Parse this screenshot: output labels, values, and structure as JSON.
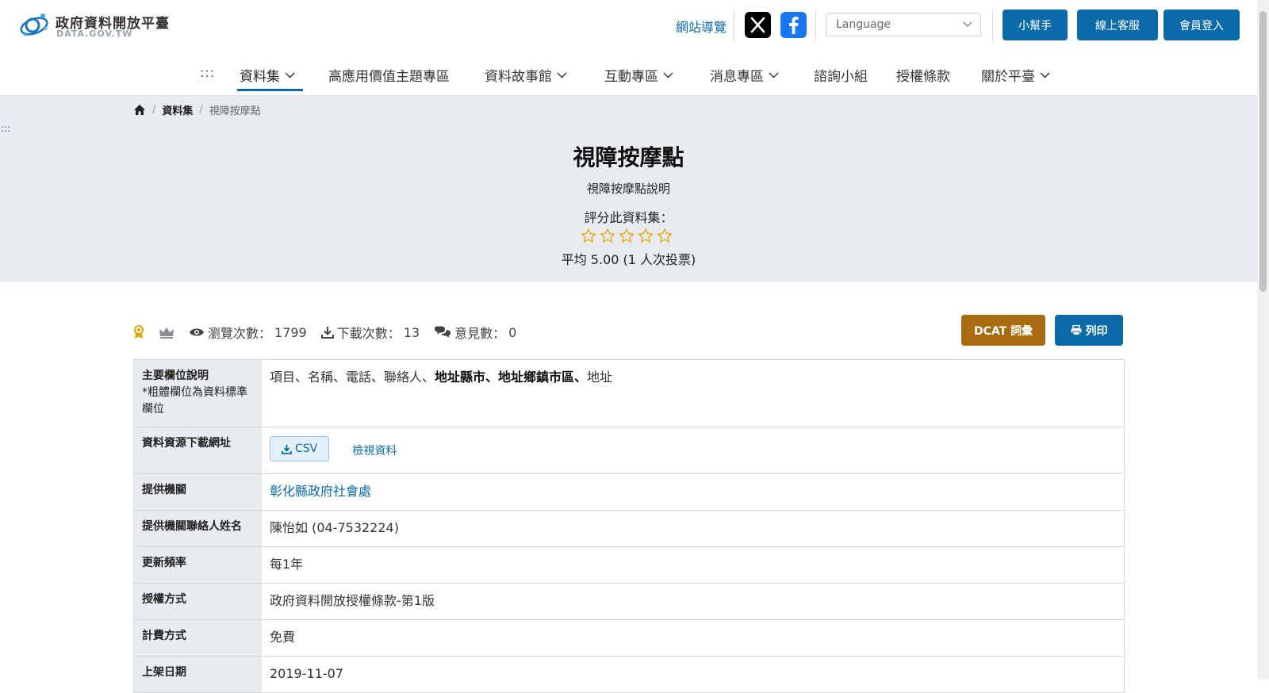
{
  "header": {
    "logo_title": "政府資料開放平臺",
    "logo_sub": "DATA.GOV.TW",
    "site_nav": "網站導覽",
    "language_placeholder": "Language",
    "buttons": {
      "helper": "小幫手",
      "service": "線上客服",
      "login": "會員登入"
    }
  },
  "nav": {
    "menu_dots": ":::",
    "items": [
      {
        "label": "資料集",
        "has_dropdown": true,
        "active": true
      },
      {
        "label": "高應用價值主題專區",
        "has_dropdown": false
      },
      {
        "label": "資料故事館",
        "has_dropdown": true
      },
      {
        "label": "互動專區",
        "has_dropdown": true
      },
      {
        "label": "消息專區",
        "has_dropdown": true
      },
      {
        "label": "諮詢小組",
        "has_dropdown": false
      },
      {
        "label": "授權條款",
        "has_dropdown": false
      },
      {
        "label": "關於平臺",
        "has_dropdown": true
      }
    ]
  },
  "breadcrumb": {
    "level1": "資料集",
    "current": "視障按摩點",
    "side_dots": ":::"
  },
  "dataset": {
    "title": "視障按摩點",
    "description": "視障按摩點說明",
    "rate_label": "評分此資料集：",
    "stars_total": 5,
    "stars_filled": 0,
    "average": "平均 5.00 (1 人次投票)"
  },
  "stats": {
    "views_label": "瀏覽次數：",
    "views": "1799",
    "downloads_label": "下載次數：",
    "downloads": "13",
    "comments_label": "意見數：",
    "comments": "0"
  },
  "actions": {
    "dcat": "DCAT 詞彙",
    "print": "列印"
  },
  "details": {
    "fields_label": "主要欄位說明",
    "fields_note": "*粗體欄位為資料標準欄位",
    "fields_plain_1": "項目、名稱、電話、聯絡人、",
    "fields_bold": "地址縣市、地址鄉鎮市區、",
    "fields_plain_2": "地址",
    "download_label": "資料資源下載網址",
    "csv_label": "CSV",
    "view_data": "檢視資料",
    "provider_label": "提供機關",
    "provider": "彰化縣政府社會處",
    "contact_label": "提供機關聯絡人姓名",
    "contact": "陳怡如 (04-7532224)",
    "frequency_label": "更新頻率",
    "frequency": "每1年",
    "license_label": "授權方式",
    "license": "政府資料開放授權條款-第1版",
    "fee_label": "計費方式",
    "fee": "免費",
    "published_label": "上架日期",
    "published": "2019-11-07"
  },
  "colors": {
    "primary": "#0b6aa8",
    "dcat": "#a86b10",
    "hero_bg": "#e8ecf0",
    "star": "#e0a800"
  }
}
